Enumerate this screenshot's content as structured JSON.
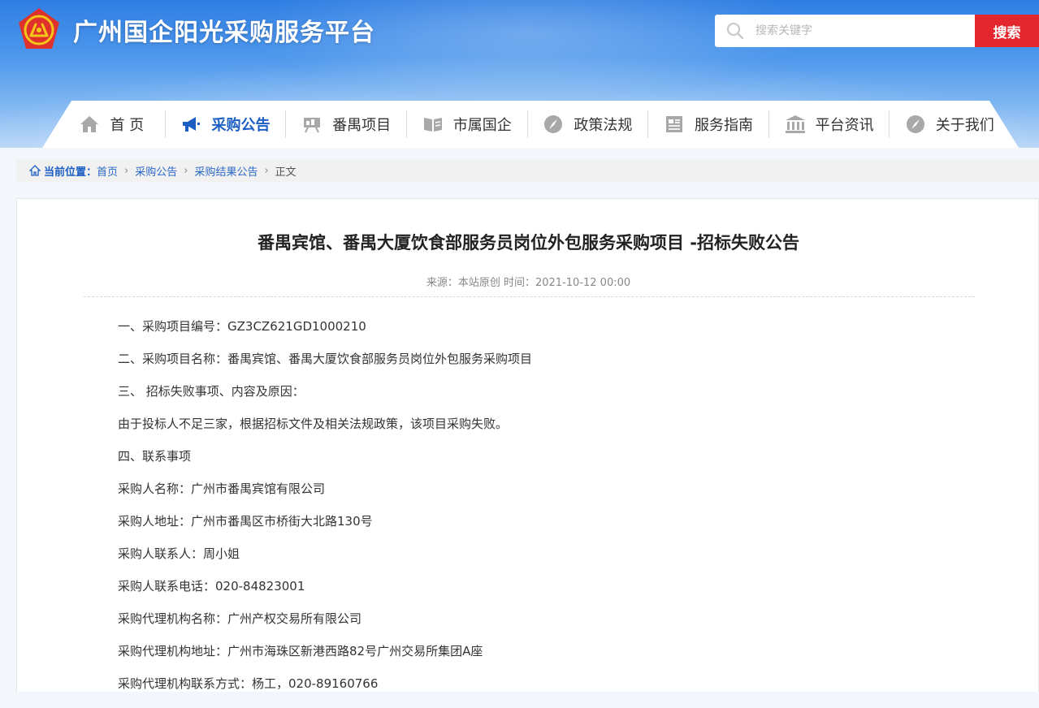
{
  "header": {
    "site_title": "广州国企阳光采购服务平台",
    "logo_text": "公",
    "search_placeholder": "搜索关键字",
    "search_button": "搜索"
  },
  "nav": {
    "items": [
      {
        "label": "首 页",
        "icon": "home-icon",
        "active": false
      },
      {
        "label": "采购公告",
        "icon": "megaphone-icon",
        "active": true
      },
      {
        "label": "番禺项目",
        "icon": "easel-icon",
        "active": false
      },
      {
        "label": "市属国企",
        "icon": "book-icon",
        "active": false
      },
      {
        "label": "政策法规",
        "icon": "compass-icon",
        "active": false
      },
      {
        "label": "服务指南",
        "icon": "document-icon",
        "active": false
      },
      {
        "label": "平台资讯",
        "icon": "building-icon",
        "active": false
      },
      {
        "label": "关于我们",
        "icon": "compass-icon",
        "active": false
      }
    ]
  },
  "breadcrumb": {
    "label": "当前位置：",
    "links": [
      "首页",
      "采购公告",
      "采购结果公告"
    ],
    "current": "正文"
  },
  "article": {
    "title": "番禺宾馆、番禺大厦饮食部服务员岗位外包服务采购项目 -招标失败公告",
    "meta": "来源：本站原创 时间：2021-10-12 00:00",
    "paragraphs": [
      "一、采购项目编号：GZ3CZ621GD1000210",
      "二、采购项目名称：番禺宾馆、番禺大厦饮食部服务员岗位外包服务采购项目",
      "三、 招标失败事项、内容及原因：",
      "由于投标人不足三家，根据招标文件及相关法规政策，该项目采购失败。",
      "四、联系事项",
      "采购人名称：广州市番禺宾馆有限公司",
      "采购人地址：广州市番禺区市桥街大北路130号",
      "采购人联系人：周小姐",
      "采购人联系电话：020-84823001",
      "采购代理机构名称：广州产权交易所有限公司",
      "采购代理机构地址：广州市海珠区新港西路82号广州交易所集团A座",
      "采购代理机构联系方式：杨工，020-89160766"
    ]
  },
  "colors": {
    "brand_blue": "#1c5fc4",
    "search_red": "#e4262f",
    "logo_red": "#e0322c",
    "logo_gold": "#f5c518"
  }
}
